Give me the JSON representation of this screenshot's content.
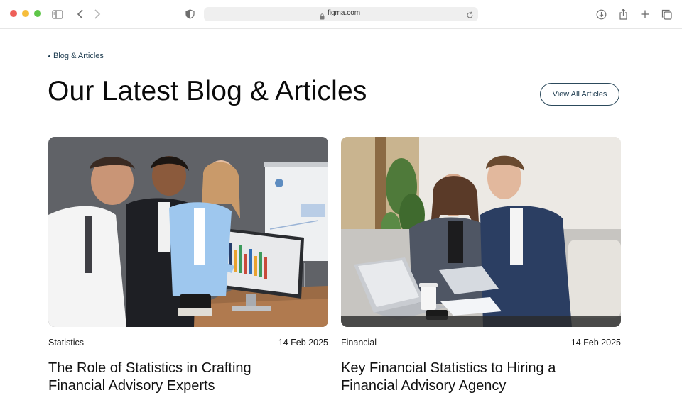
{
  "browser": {
    "url": "figma.com",
    "icons": [
      "sidebar-toggle-icon",
      "back-arrow-icon",
      "forward-arrow-icon",
      "shield-icon",
      "lock-icon",
      "reload-icon",
      "download-icon",
      "share-icon",
      "new-tab-plus-icon",
      "tab-overview-icon"
    ]
  },
  "section": {
    "eyebrow": "Blog & Articles",
    "heading": "Our Latest Blog & Articles",
    "view_all_label": "View All Articles"
  },
  "posts": [
    {
      "category": "Statistics",
      "date": "14 Feb 2025",
      "title_line1": "The Role of Statistics in Crafting",
      "title_line2": "Financial Advisory Experts"
    },
    {
      "category": "Financial",
      "date": "14 Feb 2025",
      "title_line1": "Key Financial Statistics to Hiring a",
      "title_line2": "Financial Advisory Agency"
    }
  ],
  "colors": {
    "accent": "#1d3b4f",
    "heading": "#0a0a0a",
    "chrome_bar": "#efefef"
  }
}
